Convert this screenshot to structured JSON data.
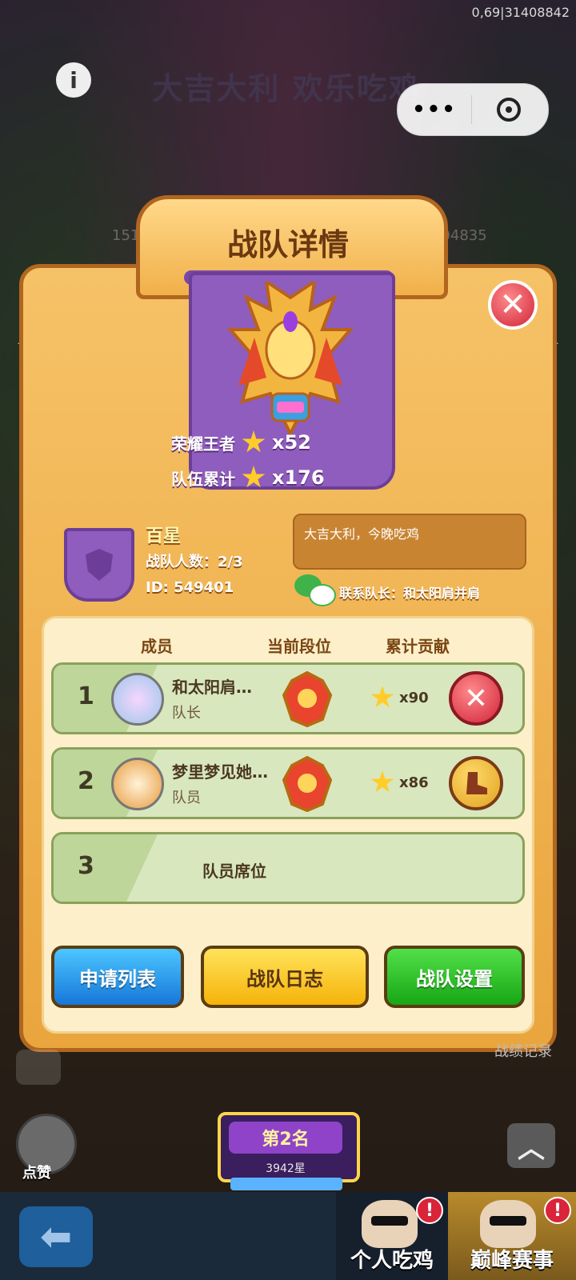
{
  "top_id": "0,69|31408842",
  "background": {
    "banner_title": "大吉大利 欢乐吃鸡",
    "numbers": [
      "151567",
      "604835"
    ]
  },
  "capsule": {
    "more_icon": "ellipsis-icon",
    "target_icon": "target-icon"
  },
  "panel": {
    "title": "战队详情",
    "achievements": [
      {
        "label": "荣耀王者",
        "value": "x52"
      },
      {
        "label": "队伍累计",
        "value": "x176"
      }
    ],
    "team": {
      "name": "百星",
      "count": "战队人数：2/3",
      "id": "ID: 549401",
      "motto": "大吉大利，今晚吃鸡",
      "contact": "联系队长：和太阳肩并肩"
    },
    "columns": [
      "成员",
      "当前段位",
      "累计贡献"
    ],
    "members": [
      {
        "rank": "1",
        "name": "和太阳肩…",
        "role": "队长",
        "contribution": "x90",
        "action_icon": "close-icon"
      },
      {
        "rank": "2",
        "name": "梦里梦见她…",
        "role": "队员",
        "contribution": "x86",
        "action_icon": "boot-icon"
      }
    ],
    "empty_seat": {
      "rank": "3",
      "label": "队员席位"
    },
    "buttons": {
      "apply": "申请列表",
      "log": "战队日志",
      "settings": "战队设置"
    }
  },
  "side": {
    "record_text": "战绩记录",
    "like_label": "点赞"
  },
  "rank_card": {
    "title": "第2名",
    "stars": "3942星"
  },
  "bottom": {
    "tab_personal": "个人吃鸡",
    "tab_peak": "巅峰赛事",
    "alert": "!"
  },
  "colors": {
    "accent": "#f1b04a",
    "close": "#d1243a",
    "green": "#17a615",
    "blue": "#1677d9"
  }
}
